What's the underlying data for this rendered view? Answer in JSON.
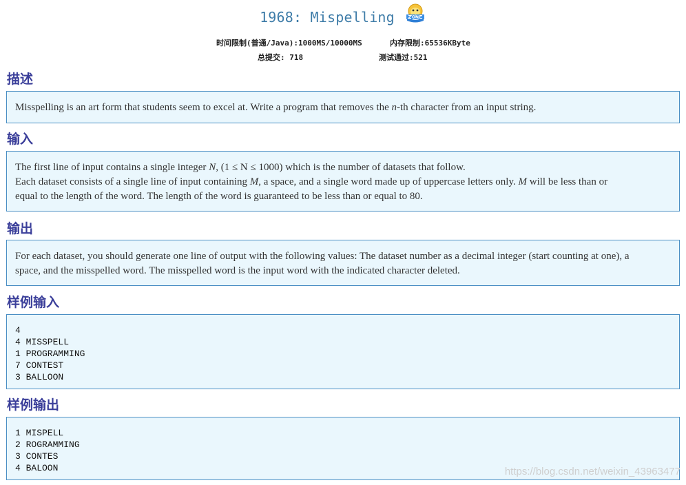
{
  "problem": {
    "title": "1968: Mispelling",
    "time_limit": "时间限制(普通/Java):1000MS/10000MS",
    "memory_limit": "内存限制:65536KByte",
    "total_submissions": "总提交: 718",
    "accepted": "测试通过:521"
  },
  "sections": {
    "description_title": "描述",
    "description_text_1": "Misspelling is an art form that students seem to excel at. Write a program that removes the ",
    "description_var": "n",
    "description_text_2": "-th character from an input string.",
    "input_title": "输入",
    "input_line1_a": "The first line of input contains a single integer ",
    "input_line1_var": "N",
    "input_line1_b": ", (1 ≤ N ≤ 1000) which is the number of datasets that follow.",
    "input_line2_a": "Each dataset consists of a single line of input containing ",
    "input_line2_var1": "M",
    "input_line2_b": ", a space, and a single word made up of uppercase letters only. ",
    "input_line2_var2": "M",
    "input_line2_c": " will be less than or",
    "input_line3": "equal to the length of the word. The length of the word is guaranteed to be less than or equal to 80.",
    "output_title": "输出",
    "output_line1": "For each dataset, you should generate one line of output with the following values: The dataset number as a decimal integer (start counting at one), a",
    "output_line2": "space, and the misspelled word. The misspelled word is the input word with the indicated character deleted.",
    "sample_input_title": "样例输入",
    "sample_input": [
      "4",
      "4 MISSPELL",
      "1 PROGRAMMING",
      "7 CONTEST",
      "3 BALLOON"
    ],
    "sample_output_title": "样例输出",
    "sample_output": [
      "1 MISPELL",
      "2 ROGRAMMING",
      "3 CONTES",
      "4 BALOON"
    ]
  },
  "icons": {
    "logo": "qzone-icon"
  },
  "watermark": "https://blog.csdn.net/weixin_43963477"
}
